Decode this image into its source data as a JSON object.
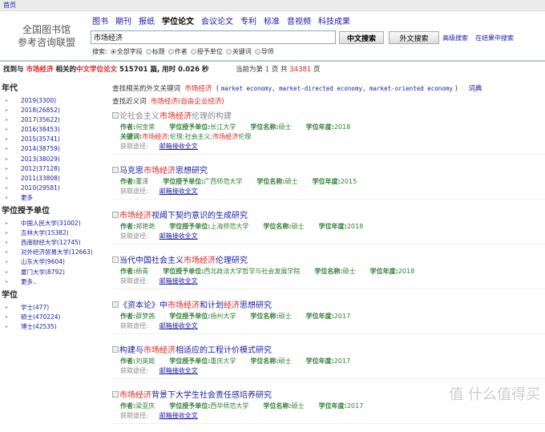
{
  "topbar": {
    "home": "首页"
  },
  "logo": {
    "line1": "全国图书馆",
    "line2": "参考咨询联盟"
  },
  "nav": [
    "图书",
    "期刊",
    "报纸",
    "学位论文",
    "会议论文",
    "专利",
    "标准",
    "音视频",
    "科技成果"
  ],
  "nav_active": 3,
  "search": {
    "value": "市场经济",
    "cn_button": "中文搜索",
    "foreign_button": "外文搜索",
    "advanced": "高级搜索",
    "in_results": "在结果中搜索",
    "label": "搜索:",
    "fields": [
      "全部字段",
      "标题",
      "作者",
      "授予单位",
      "关键词",
      "导师"
    ],
    "selected": 0
  },
  "summary": {
    "prefix": "找到与",
    "term": "市场经济",
    "mid": "相关的",
    "type": "中文学位论文",
    "count": "515701",
    "suffix": "篇, 用时",
    "time": "0.026",
    "sec": "秒",
    "page_prefix": "当前为第",
    "page": "1",
    "page_mid": "页 共",
    "total_pages": "34381",
    "page_suffix": "页"
  },
  "sidebar": [
    {
      "title": "年代",
      "items": [
        "2019(3300)",
        "2018(26852)",
        "2017(35622)",
        "2016(38453)",
        "2015(35741)",
        "2014(38759)",
        "2013(38029)",
        "2012(37128)",
        "2011(33808)",
        "2010(29581)",
        "更多"
      ]
    },
    {
      "title": "学位授予单位",
      "items": [
        "中国人民大学(31002)",
        "吉林大学(15382)",
        "西南财经大学(12745)",
        "对外经济贸易大学(12663)",
        "山东大学(9604)",
        "厦门大学(8792)",
        "更多.."
      ]
    },
    {
      "title": "学位",
      "items": [
        "学士(477)",
        "硕士(470224)",
        "博士(42535)"
      ]
    }
  ],
  "related": {
    "label": "查找相关的外文关键词",
    "term": "市场经济",
    "open": "(",
    "terms": "market economy, market-directed economy, market-oriented economy",
    "close": ")",
    "dict": "词典",
    "syn_label": "查找近义词",
    "syn_term": "市场经济",
    "syn_extra": "(自由企业经济)"
  },
  "labels": {
    "author": "作者:",
    "unit": "学位授予单位:",
    "degree": "学位名称:",
    "year": "学位年度:",
    "keywords": "关键词:",
    "via": "获取途径:",
    "via_link": "邮箱接收全文"
  },
  "results": [
    {
      "title": [
        [
          "论社会主义",
          0
        ],
        [
          "市场经济",
          1
        ],
        [
          "伦理的构建",
          0
        ]
      ],
      "author": "何金荣",
      "unit": "长江大学",
      "degree": "硕士",
      "year": "2018",
      "keywords": [
        [
          "市场经济",
          1
        ],
        [
          ";伦理;社会主义;",
          0
        ],
        [
          "市场经济",
          1
        ],
        [
          "伦理",
          0
        ]
      ],
      "visited": true
    },
    {
      "title": [
        [
          "马克思",
          0
        ],
        [
          "市场经济",
          1
        ],
        [
          "思想研究",
          0
        ]
      ],
      "author": "董泽",
      "unit": "广西师范大学",
      "degree": "硕士",
      "year": "2015"
    },
    {
      "title": [
        [
          "市场经济",
          1
        ],
        [
          "视阈下契约意识的生成研究",
          0
        ]
      ],
      "author": "郑艳艳",
      "unit": "上海师范大学",
      "degree": "硕士",
      "year": "2018"
    },
    {
      "title": [
        [
          "当代中国社会主义",
          0
        ],
        [
          "市场经济",
          1
        ],
        [
          "伦理研究",
          0
        ]
      ],
      "author": "杨青",
      "unit": "西北政法大学哲学与社会发展学院",
      "degree": "硕士",
      "year": "2018"
    },
    {
      "title": [
        [
          "《资本论》中",
          0
        ],
        [
          "市场经济",
          1
        ],
        [
          "和计划",
          0
        ],
        [
          "经济",
          1
        ],
        [
          "思想研究",
          0
        ]
      ],
      "author": "薛梦茜",
      "unit": "扬州大学",
      "degree": "硕士",
      "year": "2017"
    },
    {
      "title": [
        [
          "构建与",
          0
        ],
        [
          "市场经济",
          1
        ],
        [
          "相适应的工程计价模式研究",
          0
        ]
      ],
      "author": "刘英姬",
      "unit": "重庆大学",
      "degree": "硕士",
      "year": "2017"
    },
    {
      "title": [
        [
          "市场经济",
          1
        ],
        [
          "背景下大学生社会责任感培养研究",
          0
        ]
      ],
      "author": "梁亚庆",
      "unit": "西华师范大学",
      "degree": "硕士",
      "year": "2017"
    }
  ],
  "watermark": "值 什么值得买"
}
